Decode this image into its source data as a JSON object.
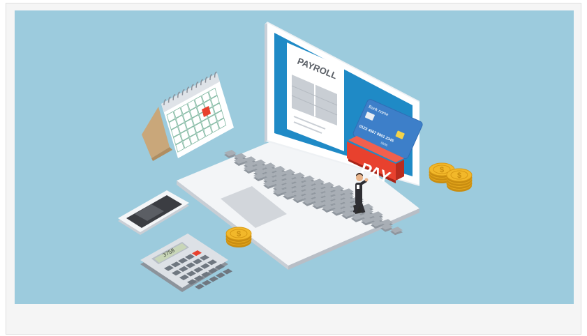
{
  "illustration": {
    "document_heading": "PAYROLL",
    "card_bank_label": "Bank name",
    "card_number": "0123 4567 8901 2345",
    "card_expiry": "00/00",
    "pay_button_label": "PAY",
    "calculator_display": "3758",
    "coin_symbol": "$",
    "colors": {
      "background": "#9ccbdd",
      "pay_button": "#e8412e",
      "card": "#3d7fc9",
      "screen_bg": "#1f8ac6",
      "coins": "#f2b82a"
    }
  }
}
